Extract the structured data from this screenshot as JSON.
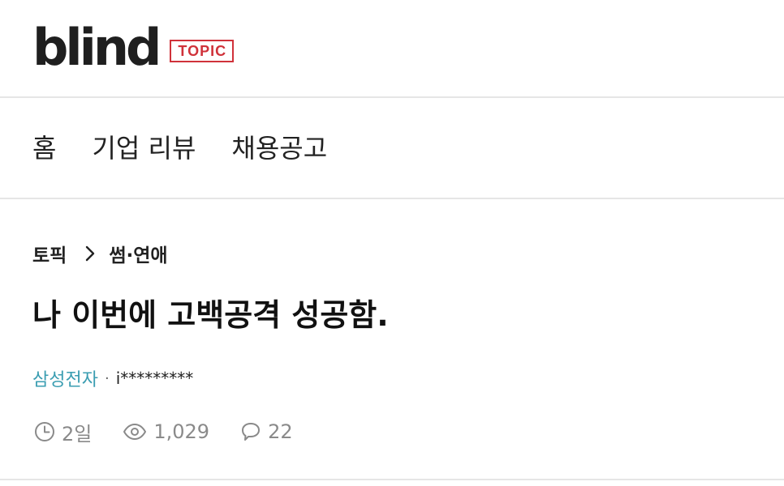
{
  "header": {
    "brand_word": "blind",
    "brand_badge": "TOPIC",
    "brand_color": "#1f1f1f",
    "badge_color": "#d0323a"
  },
  "nav": {
    "items": [
      {
        "label": "홈"
      },
      {
        "label": "기업 리뷰"
      },
      {
        "label": "채용공고"
      }
    ]
  },
  "article": {
    "breadcrumb": {
      "root": "토픽",
      "separator_icon": "chevron-right-icon",
      "category": "썸·연애"
    },
    "title": "나 이번에 고백공격 성공함.",
    "company": "삼성전자",
    "company_color": "#3a9db1",
    "author_separator": "·",
    "nickname": "i*********",
    "stats": {
      "time_icon": "clock-icon",
      "time": "2일",
      "views_icon": "eye-icon",
      "views": "1,029",
      "comments_icon": "comment-icon",
      "comments": "22"
    }
  }
}
